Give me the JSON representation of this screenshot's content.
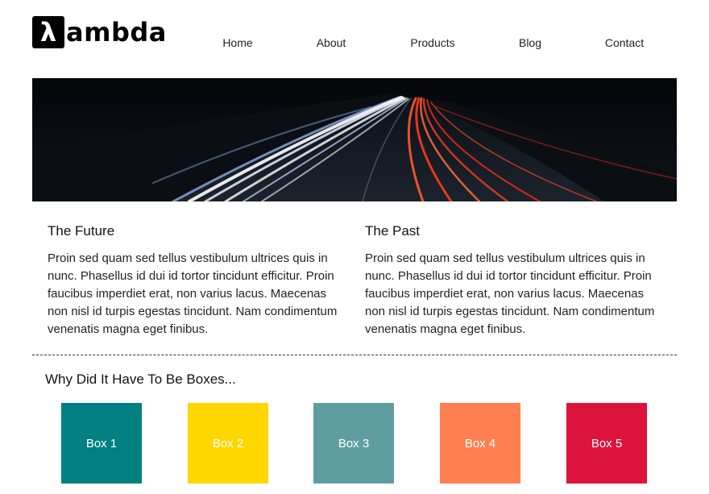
{
  "logo": {
    "mark": "λ",
    "text": "ambda"
  },
  "nav": {
    "items": [
      {
        "label": "Home"
      },
      {
        "label": "About"
      },
      {
        "label": "Products"
      },
      {
        "label": "Blog"
      },
      {
        "label": "Contact"
      }
    ]
  },
  "content": {
    "left": {
      "title": "The Future",
      "body": "Proin sed quam sed tellus vestibulum ultrices quis in nunc. Phasellus id dui id tortor tincidunt efficitur. Proin faucibus imperdiet erat, non varius lacus. Maecenas non nisl id turpis egestas tincidunt. Nam condimentum venenatis magna eget finibus."
    },
    "right": {
      "title": "The Past",
      "body": "Proin sed quam sed tellus vestibulum ultrices quis in nunc. Phasellus id dui id tortor tincidunt efficitur. Proin faucibus imperdiet erat, non varius lacus. Maecenas non nisl id turpis egestas tincidunt. Nam condimentum venenatis magna eget finibus."
    }
  },
  "boxes": {
    "title": "Why Did It Have To Be Boxes...",
    "items": [
      {
        "label": "Box 1",
        "color": "#008080"
      },
      {
        "label": "Box 2",
        "color": "#FFD700"
      },
      {
        "label": "Box 3",
        "color": "#5F9EA0"
      },
      {
        "label": "Box 4",
        "color": "#FF7F50"
      },
      {
        "label": "Box 5",
        "color": "#DC143C"
      }
    ]
  }
}
